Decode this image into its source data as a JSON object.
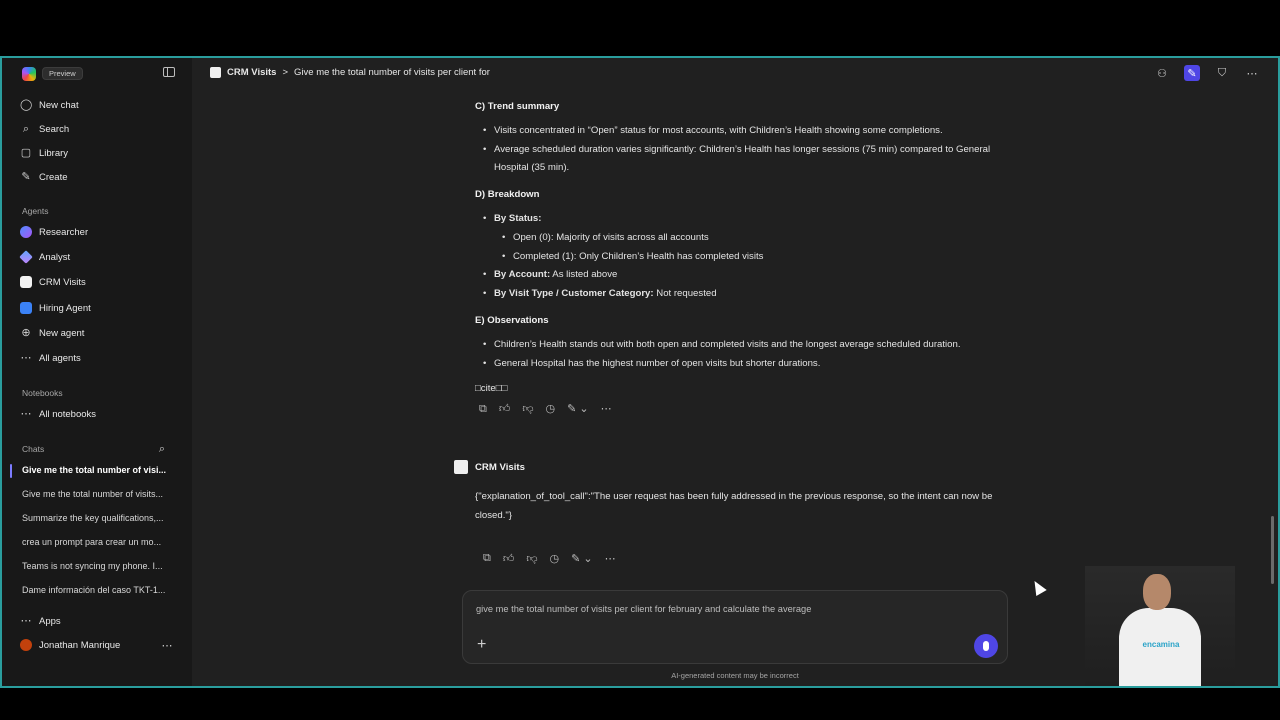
{
  "sidebar": {
    "preview_label": "Preview",
    "nav": [
      {
        "label": "New chat",
        "icon": "new-chat-icon"
      },
      {
        "label": "Search",
        "icon": "search-icon"
      },
      {
        "label": "Library",
        "icon": "library-icon"
      },
      {
        "label": "Create",
        "icon": "create-icon"
      }
    ],
    "agents_heading": "Agents",
    "agents": [
      {
        "label": "Researcher",
        "icon": "researcher-icon"
      },
      {
        "label": "Analyst",
        "icon": "analyst-icon"
      },
      {
        "label": "CRM Visits",
        "icon": "crm-visits-icon"
      },
      {
        "label": "Hiring Agent",
        "icon": "hiring-agent-icon"
      },
      {
        "label": "New agent",
        "icon": "new-agent-icon"
      },
      {
        "label": "All agents",
        "icon": "all-agents-icon"
      }
    ],
    "notebooks_heading": "Notebooks",
    "all_notebooks": "All notebooks",
    "chats_heading": "Chats",
    "chats": [
      "Give me the total number of visi...",
      "Give me the total number of visits...",
      "Summarize the key qualifications,...",
      "crea un prompt para crear un mo...",
      "Teams is not syncing my phone. I...",
      "Dame información del caso TKT-1..."
    ],
    "apps": "Apps",
    "user_name": "Jonathan Manrique"
  },
  "header": {
    "agent": "CRM Visits",
    "separator": ">",
    "title": "Give me the total number of visits per client for"
  },
  "response": {
    "trend_heading": "C) Trend summary",
    "trend_items": [
      "Visits concentrated in “Open” status for most accounts, with Children’s Health showing some completions.",
      "Average scheduled duration varies significantly: Children’s Health has longer sessions (75 min) compared to General Hospital (35 min)."
    ],
    "breakdown_heading": "D) Breakdown",
    "by_status_label": "By Status:",
    "status_items": [
      "Open (0): Majority of visits across all accounts",
      "Completed (1): Only Children’s Health has completed visits"
    ],
    "by_account_label": "By Account:",
    "by_account_value": " As listed above",
    "by_type_label": "By Visit Type / Customer Category:",
    "by_type_value": " Not requested",
    "observations_heading": "E) Observations",
    "observation_items": [
      "Children’s Health stands out with both open and completed visits and the longest average scheduled duration.",
      "General Hospital has the highest number of open visits but shorter durations."
    ],
    "cite": "cite"
  },
  "second_message": {
    "agent": "CRM Visits",
    "text": "{\"explanation_of_tool_call\":\"The user request has been fully addressed in the previous response, so the intent can now be closed.\"}"
  },
  "composer": {
    "text": "give me the total number of visits per client for february and calculate the average"
  },
  "disclaimer": "AI-generated content may be incorrect",
  "webcam": {
    "shirt_text": "encamina"
  }
}
